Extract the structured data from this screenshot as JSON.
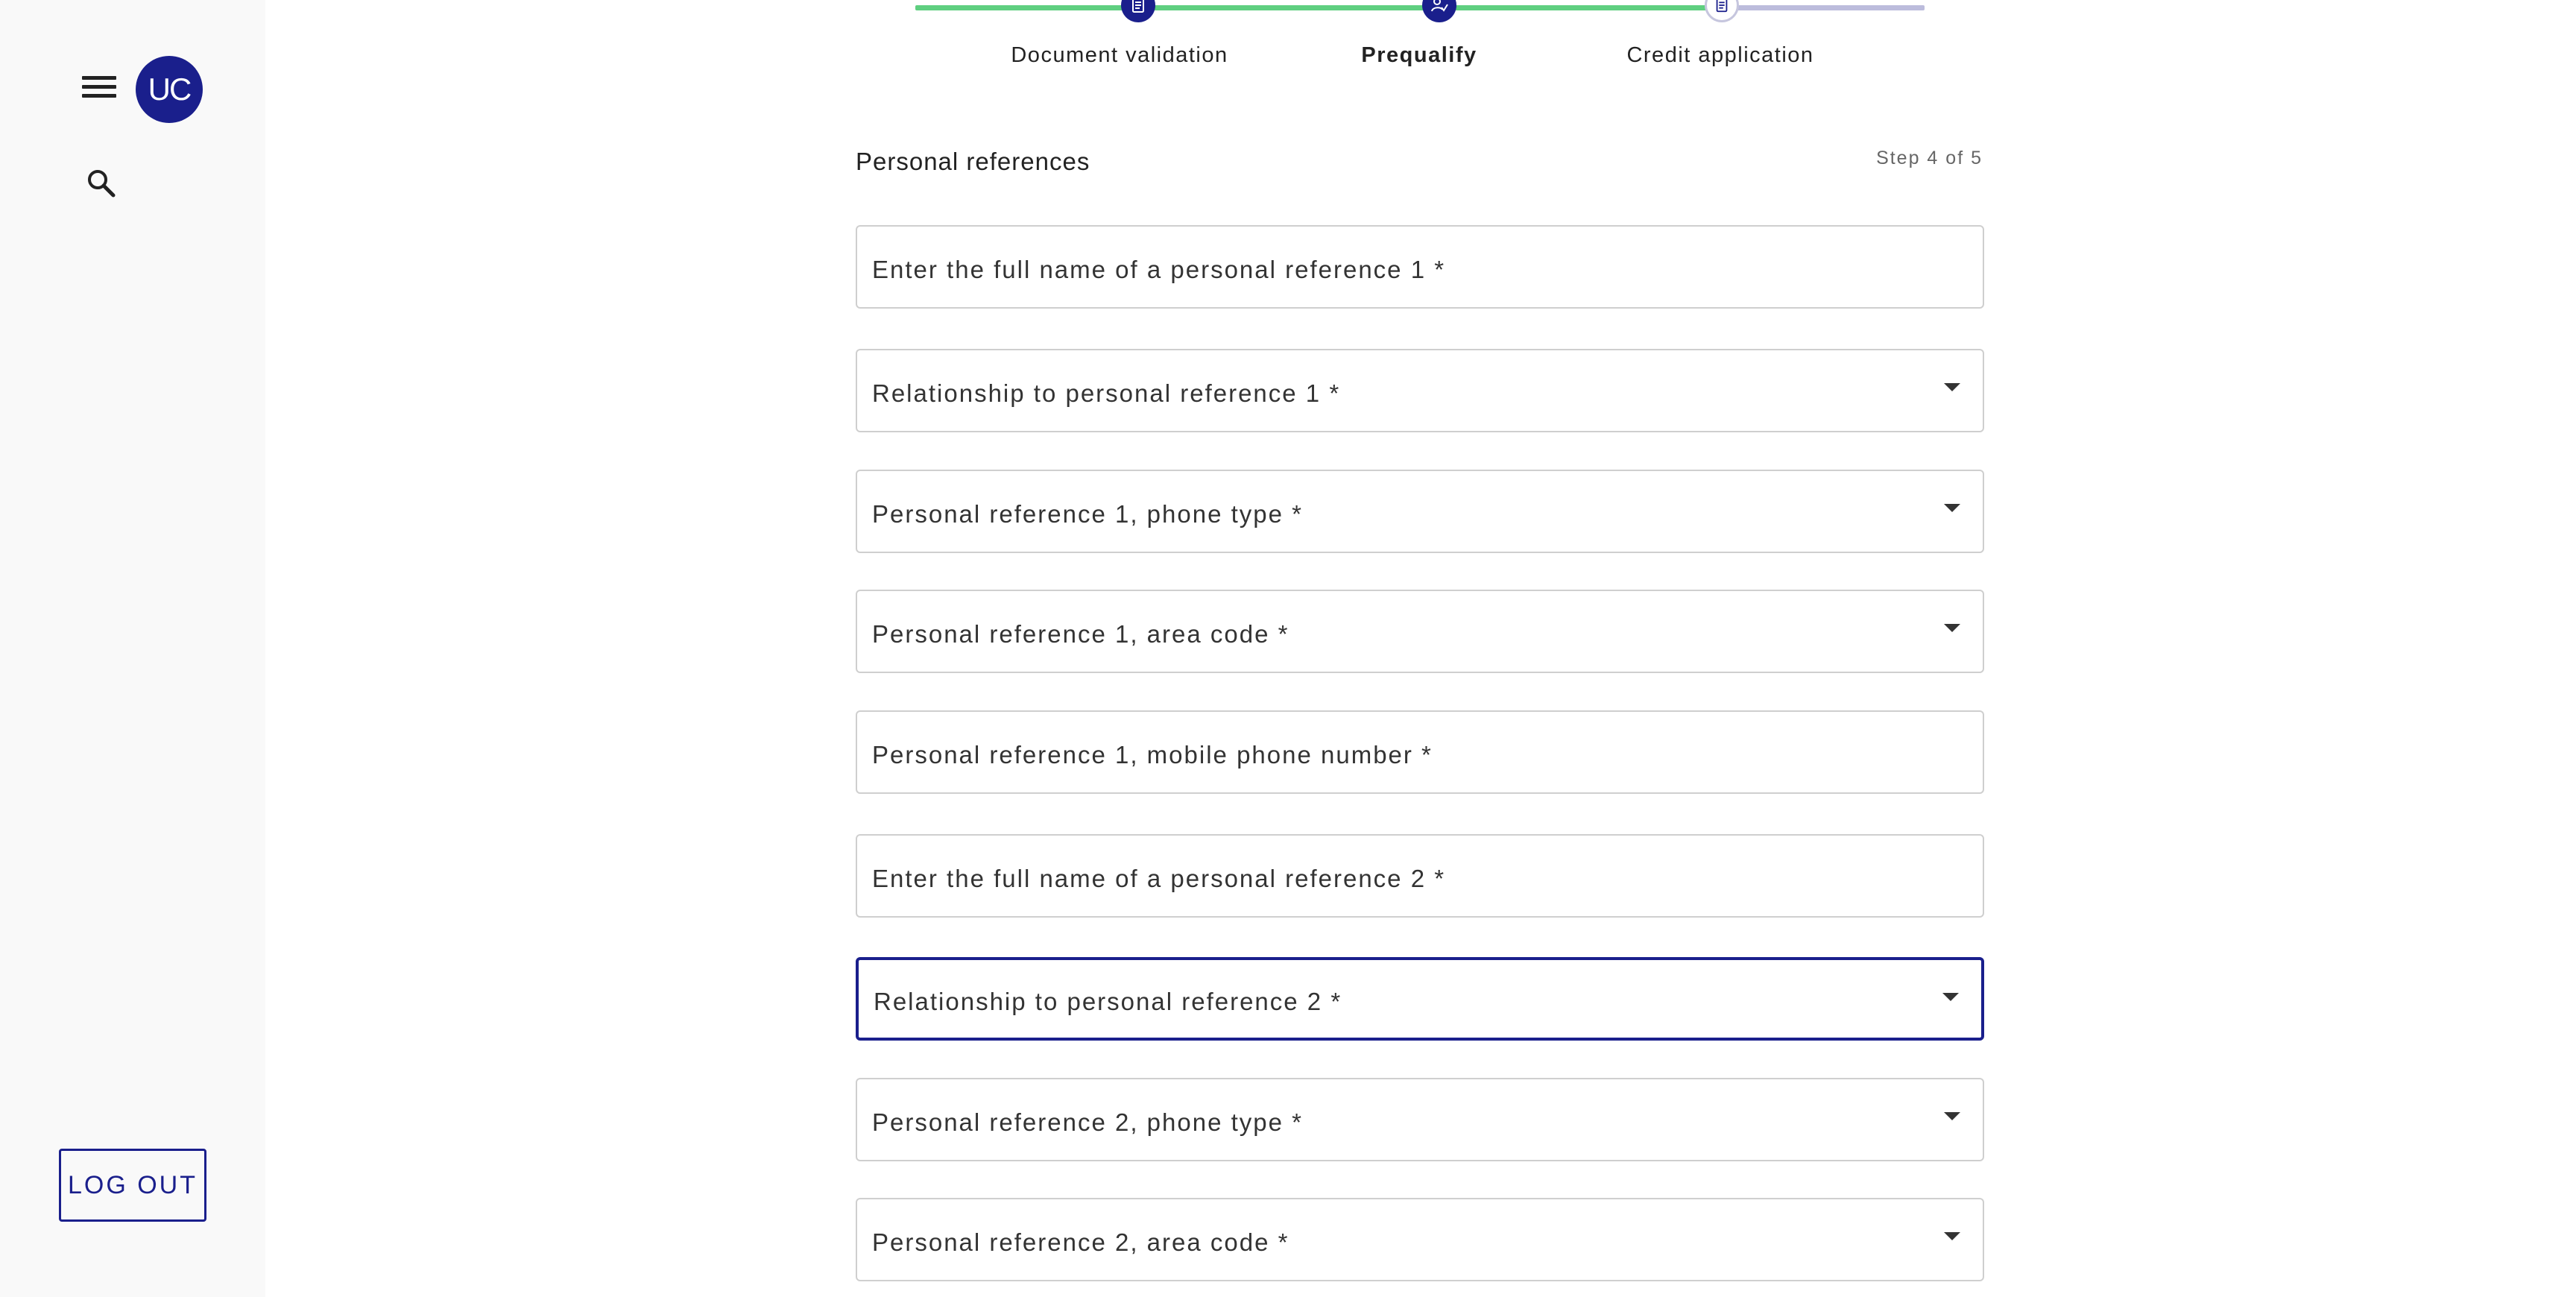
{
  "user": {
    "initials": "UC"
  },
  "sidebar": {
    "logout_label": "LOG OUT"
  },
  "stepper": {
    "steps": [
      {
        "label": "Document validation",
        "state": "done"
      },
      {
        "label": "Prequalify",
        "state": "active"
      },
      {
        "label": "Credit application",
        "state": "pending"
      }
    ]
  },
  "form": {
    "section_title": "Personal references",
    "step_indicator": "Step 4 of 5",
    "fields": [
      {
        "label": "Enter the full name of a personal reference 1 *",
        "type": "text"
      },
      {
        "label": "Relationship to personal reference 1 *",
        "type": "select"
      },
      {
        "label": "Personal reference 1, phone type *",
        "type": "select"
      },
      {
        "label": "Personal reference 1, area code *",
        "type": "select"
      },
      {
        "label": "Personal reference 1, mobile phone number *",
        "type": "text"
      },
      {
        "label": "Enter the full name of a personal reference 2 *",
        "type": "text"
      },
      {
        "label": "Relationship to personal reference 2 *",
        "type": "select",
        "focused": true
      },
      {
        "label": "Personal reference 2, phone type *",
        "type": "select"
      },
      {
        "label": "Personal reference 2, area code *",
        "type": "select"
      }
    ]
  },
  "colors": {
    "brand": "#1a1f8c",
    "progress_done": "#5fcf80",
    "progress_pending": "#bcbcdc",
    "sidebar_bg": "#f9f9f9"
  }
}
